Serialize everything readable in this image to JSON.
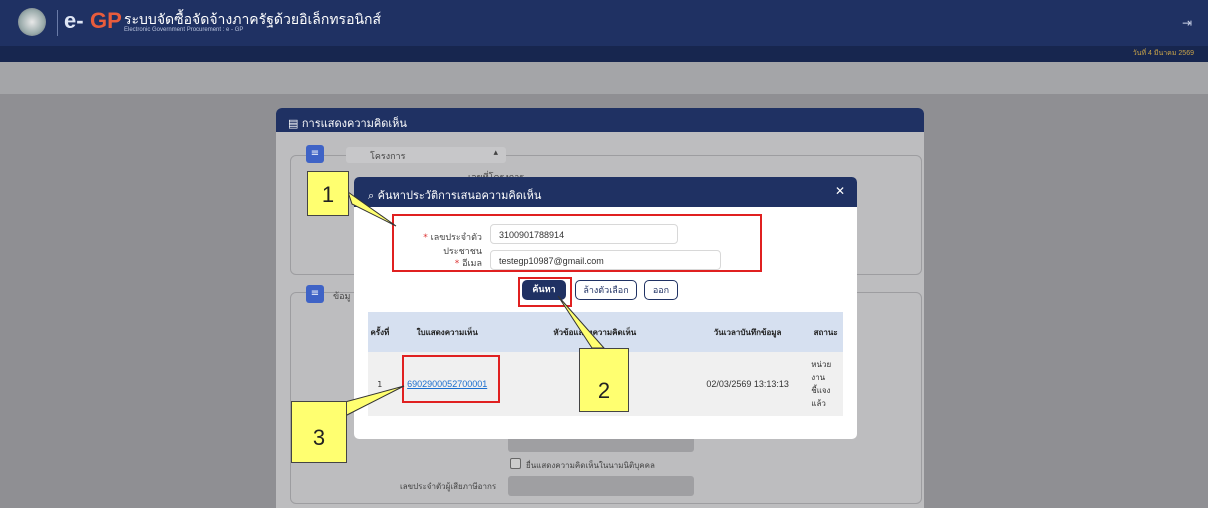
{
  "header": {
    "logo_e": "e-",
    "logo_gp": "GP",
    "title_th": "ระบบจัดซื้อจัดจ้างภาครัฐด้วยอิเล็กทรอนิกส์",
    "title_en": "Electronic Government Procurement : e - GP",
    "date": "วันที่ 4 มีนาคม 2569"
  },
  "page": {
    "card_title": "การแสดงความคิดเห็น",
    "section1": "โครงการ",
    "section2": "ข้อมู",
    "project_no_label": "เลขที่โครงการ",
    "bg_checkbox_label": "ยื่นแสดงความคิดเห็นในนามนิติบุคคล",
    "bg_taxid_label": "เลขประจำตัวผู้เสียภาษีอากร"
  },
  "modal": {
    "title": "ค้นหาประวัติการเสนอความคิดเห็น",
    "id_label": "เลขประจำตัวประชาชน",
    "id_value": "3100901788914",
    "email_label": "อีเมล",
    "email_value": "testegp10987@gmail.com",
    "btn_search": "ค้นหา",
    "btn_clear": "ล้างตัวเลือก",
    "btn_exit": "ออก",
    "columns": [
      "ครั้งที่",
      "ใบแสดงความเห็น",
      "หัวข้อแสดงความคิดเห็น",
      "วันเวลาบันทึกข้อมูล",
      "สถานะ"
    ],
    "rows": [
      {
        "no": "1",
        "doc": "6902900052700001",
        "topic": "",
        "datetime": "02/03/2569 13:13:13",
        "status": "หน่วยงานชี้แจงแล้ว"
      }
    ]
  },
  "callouts": [
    "1",
    "2",
    "3"
  ]
}
